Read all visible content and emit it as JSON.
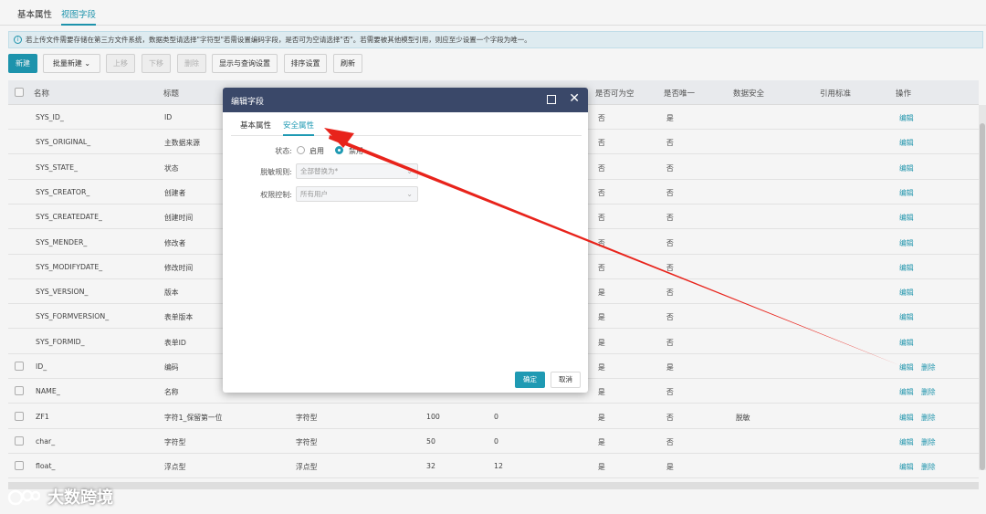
{
  "top_tabs": [
    {
      "label": "基本属性",
      "active": false
    },
    {
      "label": "视图字段",
      "active": true
    }
  ],
  "notice": "若上传文件需要存储在第三方文件系统，数据类型请选择\"字符型\"若需设置编码字段，是否可为空请选择\"否\"。若需要被其他模型引用，则应至少设置一个字段为唯一。",
  "toolbar": {
    "new": "新建",
    "batch_new": "批量新建",
    "move_up": "上移",
    "move_down": "下移",
    "delete": "删除",
    "display_query": "显示与查询设置",
    "sort_settings": "排序设置",
    "refresh": "刷新"
  },
  "table": {
    "headers": [
      "名称",
      "标题",
      "",
      "",
      "",
      "是否可为空",
      "是否唯一",
      "数据安全",
      "引用标准",
      "操作"
    ],
    "rows": [
      {
        "name": "SYS_ID_",
        "title": "ID",
        "type": "",
        "len": "",
        "dec": "",
        "nullable": "否",
        "unique": "是",
        "security": "",
        "actions": [
          "编辑"
        ],
        "checkbox": false
      },
      {
        "name": "SYS_ORIGINAL_",
        "title": "主数据来源",
        "type": "",
        "len": "",
        "dec": "",
        "nullable": "否",
        "unique": "否",
        "security": "",
        "actions": [
          "编辑"
        ],
        "checkbox": false
      },
      {
        "name": "SYS_STATE_",
        "title": "状态",
        "type": "",
        "len": "",
        "dec": "",
        "nullable": "否",
        "unique": "否",
        "security": "",
        "actions": [
          "编辑"
        ],
        "checkbox": false
      },
      {
        "name": "SYS_CREATOR_",
        "title": "创建者",
        "type": "",
        "len": "",
        "dec": "",
        "nullable": "否",
        "unique": "否",
        "security": "",
        "actions": [
          "编辑"
        ],
        "checkbox": false
      },
      {
        "name": "SYS_CREATEDATE_",
        "title": "创建时间",
        "type": "",
        "len": "",
        "dec": "",
        "nullable": "否",
        "unique": "否",
        "security": "",
        "actions": [
          "编辑"
        ],
        "checkbox": false
      },
      {
        "name": "SYS_MENDER_",
        "title": "修改者",
        "type": "",
        "len": "",
        "dec": "",
        "nullable": "否",
        "unique": "否",
        "security": "",
        "actions": [
          "编辑"
        ],
        "checkbox": false
      },
      {
        "name": "SYS_MODIFYDATE_",
        "title": "修改时间",
        "type": "",
        "len": "",
        "dec": "",
        "nullable": "否",
        "unique": "否",
        "security": "",
        "actions": [
          "编辑"
        ],
        "checkbox": false
      },
      {
        "name": "SYS_VERSION_",
        "title": "版本",
        "type": "",
        "len": "",
        "dec": "",
        "nullable": "是",
        "unique": "否",
        "security": "",
        "actions": [
          "编辑"
        ],
        "checkbox": false
      },
      {
        "name": "SYS_FORMVERSION_",
        "title": "表单版本",
        "type": "",
        "len": "",
        "dec": "",
        "nullable": "是",
        "unique": "否",
        "security": "",
        "actions": [
          "编辑"
        ],
        "checkbox": false
      },
      {
        "name": "SYS_FORMID_",
        "title": "表单ID",
        "type": "",
        "len": "",
        "dec": "",
        "nullable": "是",
        "unique": "否",
        "security": "",
        "actions": [
          "编辑"
        ],
        "checkbox": false
      },
      {
        "name": "ID_",
        "title": "编码",
        "type": "",
        "len": "",
        "dec": "",
        "nullable": "是",
        "unique": "是",
        "security": "",
        "actions": [
          "编辑",
          "删除"
        ],
        "checkbox": true
      },
      {
        "name": "NAME_",
        "title": "名称",
        "type": "",
        "len": "",
        "dec": "",
        "nullable": "是",
        "unique": "否",
        "security": "",
        "actions": [
          "编辑",
          "删除"
        ],
        "checkbox": true
      },
      {
        "name": "ZF1",
        "title": "字符1_保留第一位",
        "type": "字符型",
        "len": "100",
        "dec": "0",
        "nullable": "是",
        "unique": "否",
        "security": "脱敏",
        "actions": [
          "编辑",
          "删除"
        ],
        "checkbox": true
      },
      {
        "name": "char_",
        "title": "字符型",
        "type": "字符型",
        "len": "50",
        "dec": "0",
        "nullable": "是",
        "unique": "否",
        "security": "",
        "actions": [
          "编辑",
          "删除"
        ],
        "checkbox": true
      },
      {
        "name": "float_",
        "title": "浮点型",
        "type": "浮点型",
        "len": "32",
        "dec": "12",
        "nullable": "是",
        "unique": "是",
        "security": "",
        "actions": [
          "编辑",
          "删除"
        ],
        "checkbox": true
      }
    ]
  },
  "modal": {
    "title": "编辑字段",
    "tabs": [
      {
        "label": "基本属性",
        "active": false
      },
      {
        "label": "安全属性",
        "active": true
      }
    ],
    "status_label": "状态:",
    "status_options": [
      {
        "label": "启用",
        "selected": false
      },
      {
        "label": "禁用",
        "selected": true
      }
    ],
    "mask_rule_label": "脱敏规则:",
    "mask_rule_value": "全部替换为*",
    "permission_label": "权限控制:",
    "permission_value": "所有用户",
    "ok": "确定",
    "cancel": "取消"
  },
  "watermark": "大数跨境",
  "colors": {
    "accent": "#1f9ab3",
    "modal_header": "#3a4869",
    "arrow": "#e8231b"
  }
}
